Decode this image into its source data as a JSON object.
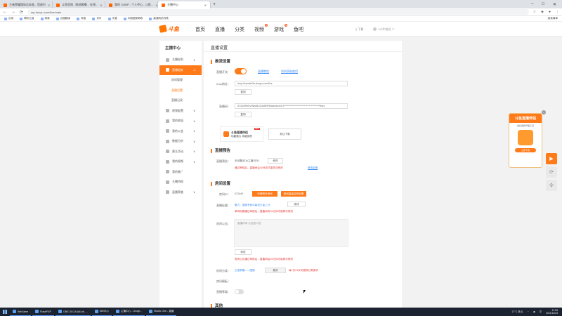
{
  "browser": {
    "tabs": [
      {
        "title": "王者荣耀国际比标准，您放行 ",
        "active": false
      },
      {
        "title": "斗鱼官网 - 图创客播... 在线...",
        "active": false
      },
      {
        "title": "我的 1080P - 个人中心 - 斗鱼...",
        "active": false
      },
      {
        "title": "主播中心",
        "active": true
      }
    ],
    "new_tab": "+",
    "window_controls": [
      "–",
      "□",
      "✕"
    ],
    "nav": {
      "back": "←",
      "forward": "→",
      "reload": "⟳"
    },
    "url": "mp.douyu.com/live/main",
    "bookmarks": [
      "应用",
      "腾讯云盘",
      "网易",
      "百度翻译",
      "淘宝",
      "京东",
      "天猫",
      "中国国家邮政",
      "高速网站列表"
    ],
    "bookmarks_right": "阅读清单"
  },
  "site": {
    "logo_text": "斗鱼",
    "nav": [
      {
        "label": "首页",
        "badge": ""
      },
      {
        "label": "直播",
        "badge": ""
      },
      {
        "label": "分类",
        "badge": ""
      },
      {
        "label": "视频",
        "badge": "N"
      },
      {
        "label": "游戏",
        "badge": "N"
      },
      {
        "label": "鱼吧",
        "badge": ""
      }
    ],
    "download_label": "下载",
    "user_label": "1小牛炫光"
  },
  "sidebar": {
    "title": "主播中心",
    "items": [
      {
        "label": "主播权利",
        "active": false,
        "arrow": "∨"
      },
      {
        "label": "直播相关",
        "active": true,
        "arrow": "∧"
      },
      {
        "label": "视频配置",
        "active": false,
        "arrow": "∨"
      },
      {
        "label": "我的收益",
        "active": false,
        "arrow": "∨"
      },
      {
        "label": "我的公会",
        "active": false,
        "arrow": "∨"
      },
      {
        "label": "数据分析",
        "active": false,
        "arrow": "∨"
      },
      {
        "label": "赛主活动",
        "active": false,
        "arrow": "∨"
      },
      {
        "label": "我的视频",
        "active": false,
        "arrow": "∨"
      },
      {
        "label": "我的推广",
        "active": false,
        "arrow": ""
      },
      {
        "label": "主播特权",
        "active": false,
        "arrow": ""
      },
      {
        "label": "直播荣誉",
        "active": false,
        "arrow": "∨"
      }
    ],
    "subitems": [
      {
        "label": "房间管理",
        "active": false
      },
      {
        "label": "直播设置",
        "active": true
      },
      {
        "label": "直播记录",
        "active": false
      }
    ]
  },
  "main": {
    "title": "直播设置",
    "stream": {
      "section": "推流设置",
      "switch_label": "直播开关：",
      "links": [
        "直播教程",
        "如何获取使用"
      ],
      "rtmp_label": "rtmp地址：",
      "rtmp_value": "rtmp://sendtc3a.douyu.com/live",
      "copy": "复制",
      "code_label": "直播码：",
      "code_value": "5734499r0VrNhkBCDAdRtPkflasSecret=l*************************************fbes",
      "promo_title": "斗鱼直播伴侣",
      "promo_sub": "功能强大 功能优质",
      "promo_badge": "NEW",
      "download_btn": "前往下载"
    },
    "preview": {
      "section": "直播预告",
      "label": "直播预告：",
      "value": "未设置(仅大主播可行)",
      "edit": "修改",
      "notice": "通过审核后，直播间会10分钟才能再次修改",
      "notice_link": "修改说明"
    },
    "room": {
      "section": "房间设置",
      "id_label": "房间ID：",
      "id_value": "573449",
      "btn_id": "申请靓号房间",
      "btn_name": "房间高级名称设置",
      "title_label": "直播标题：",
      "title_value": "魅力，国服专家中级玩王者上分",
      "edit": "修改",
      "title_notice": "单间标题通过审核后，直播间有10分钟才能再次修改",
      "notice_label": "房间公告：",
      "notice_placeholder": "直播时间 为此室口述",
      "notice_edit": "修改",
      "notice_warn": "房间公告通过审核后，直播间会10分钟才能再次修改",
      "category_label": "房间分类：",
      "category_value": "王者荣耀——国服",
      "category_edit": "更改",
      "category_note": "每7天21次可更换分类操作",
      "audit_label": "房间模板：",
      "screen_label": "直播等级："
    },
    "next_section": "其他"
  },
  "float_ad": {
    "title": "斗鱼直播伴侣",
    "sub": "最好用的开播工具",
    "btn": "立即下载",
    "close": "×"
  },
  "taskbar": {
    "items": [
      "WeGame",
      "FlashFXP",
      "OBS 25.0.8 (64-bit, ...",
      "360中心",
      "主播中心 - Googl...",
      "Studio One - 直播"
    ],
    "tray_weather": "17°C 多云",
    "tray_lang": "中",
    "clock_time": "17:53",
    "clock_date": "2021/10/23"
  }
}
